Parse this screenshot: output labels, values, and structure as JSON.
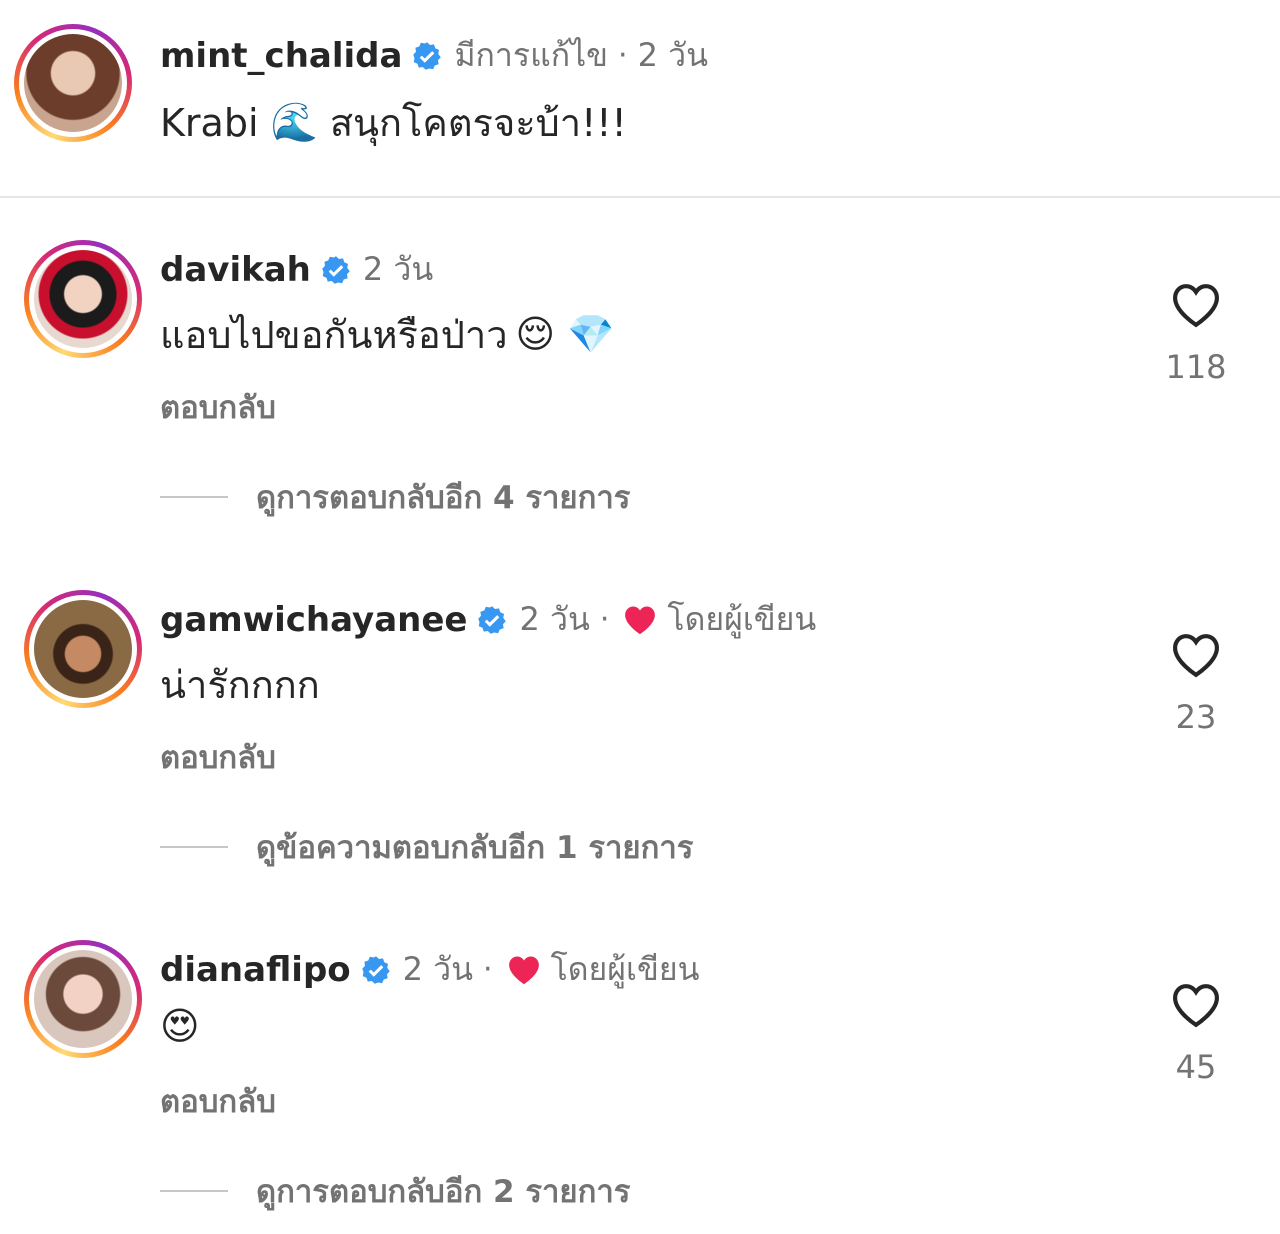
{
  "caption": {
    "username": "mint_chalida",
    "edited": "มีการแก้ไข",
    "time": "2 วัน",
    "text_prefix": "Krabi",
    "text_emoji": "🌊",
    "text_suffix": "สนุกโคตรจะบ้า!!!"
  },
  "comments": [
    {
      "username": "davikah",
      "time": "2 วัน",
      "text": "แอบไปขอกันหรือป่าว",
      "emojis": "😌 💎",
      "reply_label": "ตอบกลับ",
      "view_replies": "ดูการตอบกลับอีก 4 รายการ",
      "likes": "118"
    },
    {
      "username": "gamwichayanee",
      "time": "2 วัน",
      "author_liked": "โดยผู้เขียน",
      "text": "น่ารักกกก",
      "reply_label": "ตอบกลับ",
      "view_replies": "ดูข้อความตอบกลับอีก 1 รายการ",
      "likes": "23"
    },
    {
      "username": "dianaflipo",
      "time": "2 วัน",
      "author_liked": "โดยผู้เขียน",
      "text": "😍",
      "reply_label": "ตอบกลับ",
      "view_replies": "ดูการตอบกลับอีก 2 รายการ",
      "likes": "45"
    }
  ],
  "colors": {
    "verified": "#3897f0",
    "heart_red": "#ed2456",
    "secondary_text": "#737373"
  }
}
